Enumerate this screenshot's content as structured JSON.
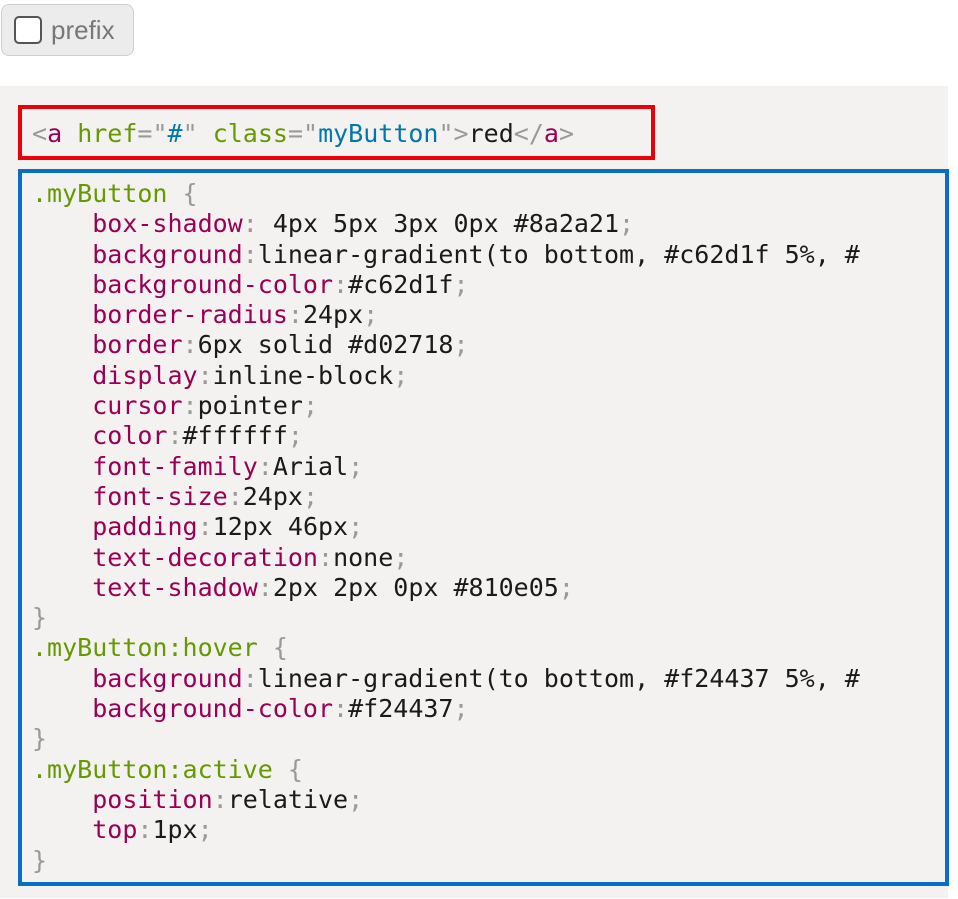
{
  "prefix_toggle": {
    "label": "prefix",
    "checked": false
  },
  "html_snippet": {
    "tag_open": "<",
    "tag_name": "a",
    "attr1_name": "href",
    "attr1_eq": "=\"",
    "attr1_value": "#",
    "attr1_close": "\"",
    "attr2_name": "class",
    "attr2_eq": "=\"",
    "attr2_value": "myButton",
    "attr2_close": "\">",
    "text": "red",
    "close_open": "</",
    "close_name": "a",
    "close_end": ">"
  },
  "css_snippet": [
    {
      "type": "selector",
      "text": ".myButton",
      "brace": " {"
    },
    {
      "type": "decl",
      "prop": "box-shadow",
      "value": " 4px 5px 3px 0px #8a2a21"
    },
    {
      "type": "decl",
      "prop": "background",
      "value": "linear-gradient(to bottom, #c62d1f 5%, #",
      "no_semicolon": true
    },
    {
      "type": "decl",
      "prop": "background-color",
      "value": "#c62d1f"
    },
    {
      "type": "decl",
      "prop": "border-radius",
      "value": "24px"
    },
    {
      "type": "decl",
      "prop": "border",
      "value": "6px solid #d02718"
    },
    {
      "type": "decl",
      "prop": "display",
      "value": "inline-block"
    },
    {
      "type": "decl",
      "prop": "cursor",
      "value": "pointer"
    },
    {
      "type": "decl",
      "prop": "color",
      "value": "#ffffff"
    },
    {
      "type": "decl",
      "prop": "font-family",
      "value": "Arial"
    },
    {
      "type": "decl",
      "prop": "font-size",
      "value": "24px"
    },
    {
      "type": "decl",
      "prop": "padding",
      "value": "12px 46px"
    },
    {
      "type": "decl",
      "prop": "text-decoration",
      "value": "none"
    },
    {
      "type": "decl",
      "prop": "text-shadow",
      "value": "2px 2px 0px #810e05"
    },
    {
      "type": "close",
      "text": "}"
    },
    {
      "type": "selector",
      "text": ".myButton:hover",
      "brace": " {"
    },
    {
      "type": "decl",
      "prop": "background",
      "value": "linear-gradient(to bottom, #f24437 5%, #",
      "no_semicolon": true
    },
    {
      "type": "decl",
      "prop": "background-color",
      "value": "#f24437"
    },
    {
      "type": "close",
      "text": "}"
    },
    {
      "type": "selector",
      "text": ".myButton:active",
      "brace": " {"
    },
    {
      "type": "decl",
      "prop": "position",
      "value": "relative"
    },
    {
      "type": "decl",
      "prop": "top",
      "value": "1px"
    },
    {
      "type": "close",
      "text": "}"
    }
  ],
  "colors": {
    "html_box_border": "#e8000b",
    "css_box_border": "#0b6ec2",
    "panel_bg": "#f4f2f0"
  }
}
